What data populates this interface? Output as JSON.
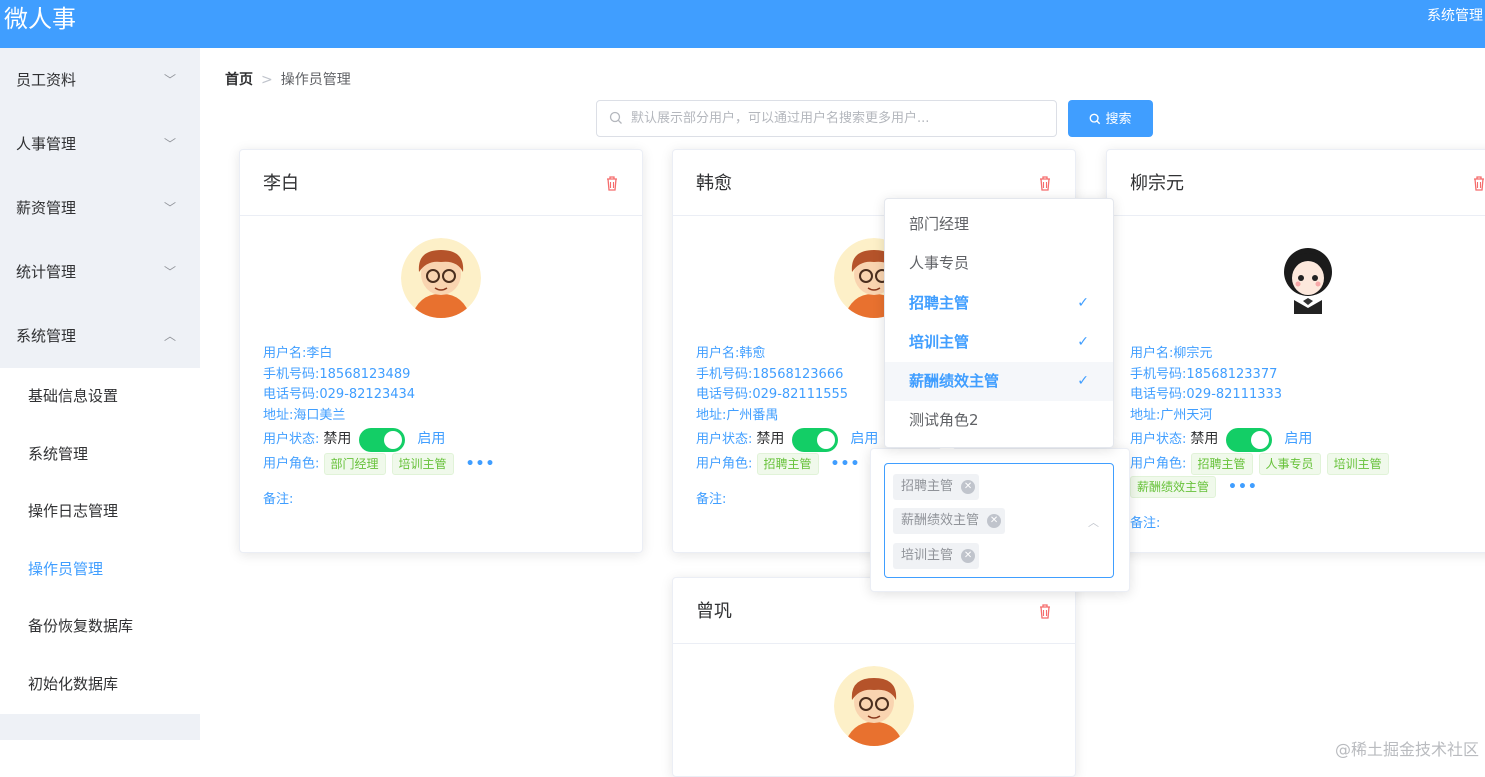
{
  "app": {
    "title": "微人事",
    "top_right": "系统管理"
  },
  "sidebar": {
    "items": [
      {
        "label": "员工资料"
      },
      {
        "label": "人事管理"
      },
      {
        "label": "薪资管理"
      },
      {
        "label": "统计管理"
      },
      {
        "label": "系统管理"
      }
    ],
    "submenu": [
      {
        "label": "基础信息设置"
      },
      {
        "label": "系统管理"
      },
      {
        "label": "操作日志管理"
      },
      {
        "label": "操作员管理"
      },
      {
        "label": "备份恢复数据库"
      },
      {
        "label": "初始化数据库"
      }
    ]
  },
  "breadcrumb": {
    "home": "首页",
    "current": "操作员管理"
  },
  "search": {
    "placeholder": "默认展示部分用户，可以通过用户名搜索更多用户...",
    "button": "搜索"
  },
  "labels": {
    "status": "用户状态:",
    "off": "禁用",
    "on": "启用",
    "roles": "用户角色:",
    "remark": "备注:",
    "more": "•••"
  },
  "cards": [
    {
      "name": "李白",
      "username": "用户名:李白",
      "phone": "手机号码:18568123489",
      "tel": "电话号码:029-82123434",
      "address": "地址:海口美兰",
      "roles": [
        "部门经理",
        "培训主管"
      ]
    },
    {
      "name": "韩愈",
      "username": "用户名:韩愈",
      "phone": "手机号码:18568123666",
      "tel": "电话号码:029-82111555",
      "address": "地址:广州番禺",
      "roles": [
        "招聘主管"
      ]
    },
    {
      "name": "柳宗元",
      "username": "用户名:柳宗元",
      "phone": "手机号码:18568123377",
      "tel": "电话号码:029-82111333",
      "address": "地址:广州天河",
      "roles": [
        "招聘主管",
        "人事专员",
        "培训主管",
        "薪酬绩效主管"
      ]
    },
    {
      "name": "曾巩"
    }
  ],
  "role_dropdown": {
    "options": [
      {
        "label": "部门经理",
        "selected": false
      },
      {
        "label": "人事专员",
        "selected": false
      },
      {
        "label": "招聘主管",
        "selected": true
      },
      {
        "label": "培训主管",
        "selected": true
      },
      {
        "label": "薪酬绩效主管",
        "selected": true
      },
      {
        "label": "测试角色2",
        "selected": false
      }
    ],
    "check": "✓"
  },
  "multi_select": {
    "tags": [
      "招聘主管",
      "薪酬绩效主管",
      "培训主管"
    ]
  },
  "watermark": "@稀土掘金技术社区",
  "colors": {
    "primary": "#409EFF",
    "switch_on": "#13ce66",
    "delete": "#f56c6c",
    "tag_green": "#67c23a"
  }
}
